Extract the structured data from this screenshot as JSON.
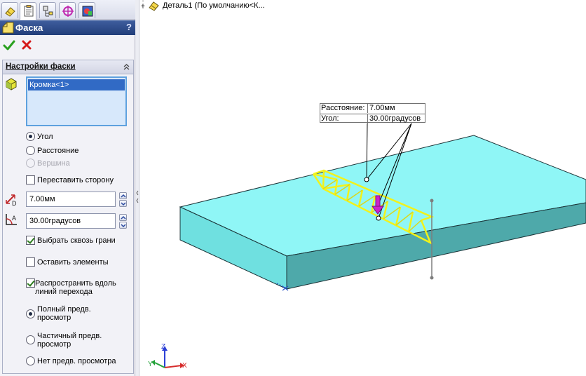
{
  "panel_tabs": [
    {
      "icon": "feature-manager-icon"
    },
    {
      "icon": "property-manager-icon"
    },
    {
      "icon": "configuration-manager-icon"
    },
    {
      "icon": "dimxpert-manager-icon"
    },
    {
      "icon": "display-manager-icon"
    }
  ],
  "property_manager": {
    "title": "Фаска",
    "help": "?"
  },
  "group": {
    "title": "Настройки фаски",
    "selection_items": [
      "Кромка<1>"
    ]
  },
  "options": {
    "angle_distance": "Угол",
    "distance_distance": "Расстояние",
    "vertex": "Вершина",
    "flip_direction": "Переставить сторону",
    "distance_value": "7.00мм",
    "angle_value": "30.00градусов",
    "select_through_faces": "Выбрать сквозь грани",
    "keep_features": "Оставить элементы",
    "tangent_propagation": "Распространить вдоль\nлиний перехода",
    "full_preview": "Полный предв.\nпросмотр",
    "partial_preview": "Частичный предв.\nпросмотр",
    "no_preview": "Нет предв. просмотра"
  },
  "state": {
    "angle_distance_selected": true,
    "flip_direction_checked": false,
    "select_through_faces_checked": true,
    "keep_features_checked": false,
    "tangent_propagation_checked": true,
    "full_preview_selected": true
  },
  "viewport": {
    "tree_label": "Деталь1  (По умолчанию<К...",
    "callout": {
      "distance_label": "Расстояние:",
      "distance_value": "7.00мм",
      "angle_label": "Угол:",
      "angle_value": "30.00градусов"
    },
    "triad": {
      "x": "X",
      "y": "Y",
      "z": "Z"
    }
  },
  "colors": {
    "part_top": "#8ff6f6",
    "part_front": "#5ecbcc",
    "part_side": "#3f8f91",
    "chamfer_preview": "#f2f21a",
    "arrow": "#cc22cc",
    "accent": "#316ac5"
  }
}
